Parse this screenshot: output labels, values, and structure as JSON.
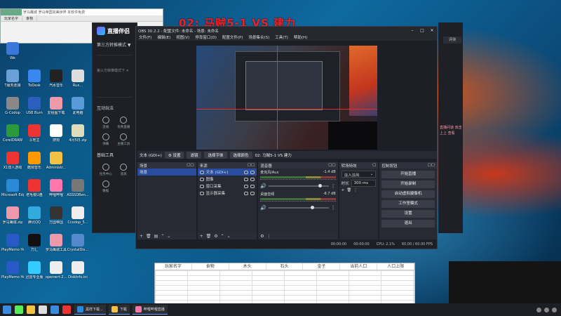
{
  "overlay_title": "02: 马贼5-1 VS 建力",
  "colors": {
    "accent": "#294c9e",
    "overlay_red": "#e5242b",
    "obs_bg": "#1d1f26"
  },
  "mini_window": {
    "title": "罗马鹰城 罗马帝国完美世界 本软件免费",
    "columns": [
      "玩家名字",
      "食物"
    ]
  },
  "desktop_icons": [
    {
      "label": "We",
      "color": "#3a77d8",
      "col": 0,
      "row": 0
    },
    {
      "label": "T服务连接",
      "color": "#6aa0d8",
      "col": 0,
      "row": 1
    },
    {
      "label": "ToDesk",
      "color": "#3b87f0",
      "col": 1,
      "row": 1
    },
    {
      "label": "汽水音乐",
      "color": "#222",
      "col": 2,
      "row": 1
    },
    {
      "label": "Rux...",
      "color": "#ddd",
      "col": 3,
      "row": 1
    },
    {
      "label": "G-Codop",
      "color": "#888",
      "col": 0,
      "row": 2
    },
    {
      "label": "USB Burn",
      "color": "#2b5ebd",
      "col": 1,
      "row": 2
    },
    {
      "label": "爱给图下载",
      "color": "#e9a",
      "col": 2,
      "row": 2
    },
    {
      "label": "此电脑",
      "color": "#5b9ad8",
      "col": 3,
      "row": 2
    },
    {
      "label": "CorelDRAW",
      "color": "#2c9a3a",
      "col": 0,
      "row": 3
    },
    {
      "label": "斗地主",
      "color": "#e33",
      "col": 1,
      "row": 3
    },
    {
      "label": "搜狗",
      "color": "#fff",
      "col": 2,
      "row": 3
    },
    {
      "label": "4月5日.zip",
      "color": "#ddb",
      "col": 3,
      "row": 3
    },
    {
      "label": "X1双人游戏",
      "color": "#e33",
      "col": 0,
      "row": 4
    },
    {
      "label": "酷狗音乐",
      "color": "#f90",
      "col": 1,
      "row": 4
    },
    {
      "label": "Administr...",
      "color": "#f3c242",
      "col": 2,
      "row": 4
    },
    {
      "label": "Microsoft Edge",
      "color": "#2a8ad8",
      "col": 0,
      "row": 5
    },
    {
      "label": "老毛桃U盘",
      "color": "#e33",
      "col": 1,
      "row": 5
    },
    {
      "label": "哔哩哔哩",
      "color": "#f7a",
      "col": 2,
      "row": 5
    },
    {
      "label": "ASSSDBen...",
      "color": "#777",
      "col": 3,
      "row": 5
    },
    {
      "label": "罗马鹰城.zip",
      "color": "#e9a",
      "col": 0,
      "row": 6
    },
    {
      "label": "腾讯QQ",
      "color": "#3ad",
      "col": 1,
      "row": 6
    },
    {
      "label": "万国帝国",
      "color": "#333",
      "col": 2,
      "row": 6
    },
    {
      "label": "Ccodop_5...",
      "color": "#eee",
      "col": 3,
      "row": 6
    },
    {
      "label": "PlayMemo Home",
      "color": "#2859c6",
      "col": 0,
      "row": 7
    },
    {
      "label": "万汇",
      "color": "#111",
      "col": 1,
      "row": 7
    },
    {
      "label": "罗马鹰城工具",
      "color": "#e9a",
      "col": 2,
      "row": 7
    },
    {
      "label": "CrystalDis...",
      "color": "#58c",
      "col": 3,
      "row": 7
    },
    {
      "label": "PlayMemo Home",
      "color": "#2859c6",
      "col": 0,
      "row": 8
    },
    {
      "label": "迅雷专业版",
      "color": "#3cf",
      "col": 1,
      "row": 8
    },
    {
      "label": "openwrt-2...",
      "color": "#eee",
      "col": 2,
      "row": 8
    },
    {
      "label": "DiskInfo.ini",
      "color": "#eee",
      "col": 3,
      "row": 8
    }
  ],
  "companion": {
    "brand": "直播伴侣",
    "mode": "第三方转推模式 ▼",
    "status": "第三方转推模式下 ✕",
    "section_interact": "互动玩法",
    "interact_items": [
      "连线",
      "优秀直播",
      "弹幕",
      "主播工具"
    ],
    "section_tools": "基础工具",
    "tool_items": [
      "任务中心",
      "道具",
      "数据"
    ]
  },
  "obs": {
    "title": "OBS 30.2.2 - 配置文件: 未命名 - 场景: 未命名",
    "menu": [
      "文件(F)",
      "编辑(E)",
      "视图(V)",
      "停靠窗口(D)",
      "配置文件(P)",
      "场景集合(S)",
      "工具(T)",
      "帮助(H)"
    ],
    "source_toolbar": {
      "source_name": "文本 (GDI+)",
      "settings": "⚙ 设置",
      "filters": "滤镜",
      "select_font": "选择字体",
      "select_color": "选择颜色",
      "text_value": "02: 马贼5-1 VS 建力"
    },
    "scenes": {
      "title": "场景",
      "items": [
        "场景"
      ]
    },
    "sources": {
      "title": "来源",
      "items": [
        "文本 (GDI+)",
        "图像",
        "窗口采集",
        "显示器采集"
      ]
    },
    "mixer": {
      "title": "混音器",
      "tracks": [
        {
          "name": "麦克风/Aux",
          "db": "-1.4 dB",
          "level": 0.85
        },
        {
          "name": "桌面音频",
          "db": "-8.7 dB",
          "level": 0.72
        }
      ]
    },
    "transitions": {
      "title": "转场特效",
      "type": "淡入淡出",
      "duration_label": "时长",
      "duration_value": "300 ms"
    },
    "controls": {
      "title": "控制按钮",
      "buttons": [
        "开始直播",
        "开始录制",
        "启动虚拟摄像机",
        "工作室模式",
        "设置",
        "退出"
      ]
    },
    "status": {
      "stream_time": "00:00:00",
      "rec_time": "00:00:00",
      "cpu": "CPU: 2.1%",
      "fps": "60.00 / 60.00 FPS"
    }
  },
  "right_panel": {
    "button": "评测",
    "text": "直播问道 双击 上上 查看"
  },
  "sheet": {
    "columns": [
      "玩家名字",
      "食物",
      "木头",
      "石头",
      "金子",
      "当前人口",
      "人口上限"
    ]
  },
  "taskbar": {
    "apps": [
      {
        "label": "黑样下载...",
        "color": "#2a8ad8"
      },
      {
        "label": "下载",
        "color": "#f3c242"
      },
      {
        "label": "哔哩哔哩直播",
        "color": "#f7a"
      }
    ]
  }
}
